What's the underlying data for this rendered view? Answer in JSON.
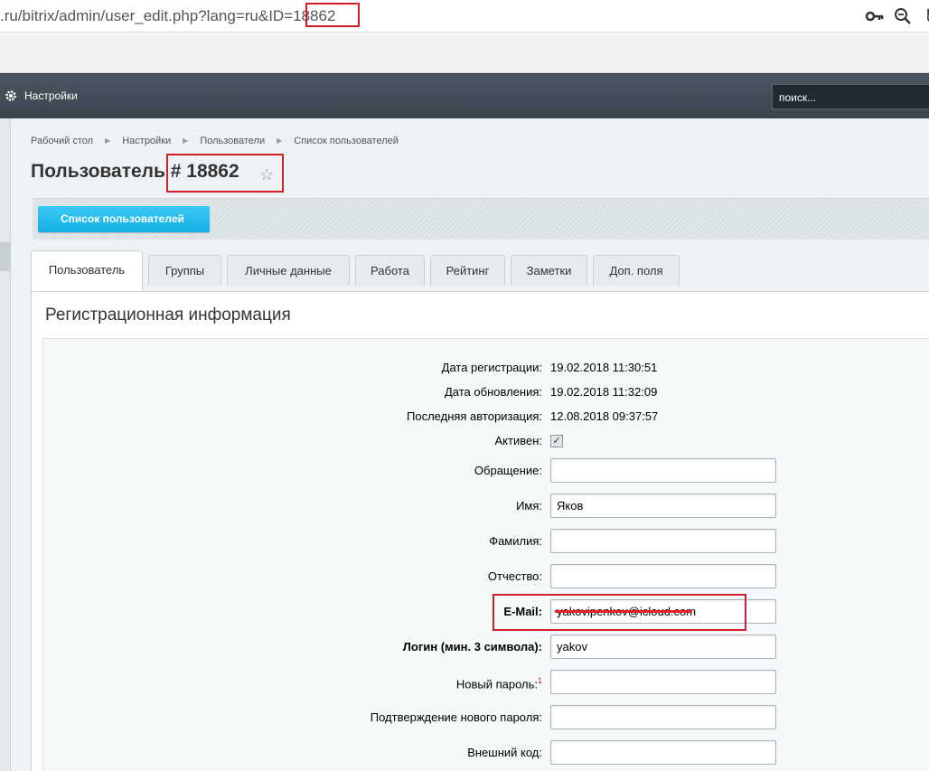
{
  "browser": {
    "url_prefix": ".ru/bitrix/admin/user_edit.php?lang=ru&ID=",
    "url_id": "18862"
  },
  "panel": {
    "settings_label": "Настройки",
    "search_placeholder": "поиск..."
  },
  "breadcrumb": [
    "Рабочий стол",
    "Настройки",
    "Пользователи",
    "Список пользователей"
  ],
  "page": {
    "title": "Пользователь # 18862",
    "list_button": "Список пользователей"
  },
  "tabs": [
    "Пользователь",
    "Группы",
    "Личные данные",
    "Работа",
    "Рейтинг",
    "Заметки",
    "Доп. поля"
  ],
  "form": {
    "section_title": "Регистрационная информация",
    "fields": {
      "reg_date": {
        "label": "Дата регистрации:",
        "value": "19.02.2018 11:30:51"
      },
      "update_date": {
        "label": "Дата обновления:",
        "value": "19.02.2018 11:32:09"
      },
      "last_login": {
        "label": "Последняя авторизация:",
        "value": "12.08.2018 09:37:57"
      },
      "active": {
        "label": "Активен:",
        "checked": true
      },
      "title": {
        "label": "Обращение:",
        "value": ""
      },
      "name": {
        "label": "Имя:",
        "value": "Яков"
      },
      "last_name": {
        "label": "Фамилия:",
        "value": ""
      },
      "second_name": {
        "label": "Отчество:",
        "value": ""
      },
      "email": {
        "label": "E-Mail:",
        "value": "yakovipenkov@icloud.com"
      },
      "login": {
        "label": "Логин (мин. 3 символа):",
        "value": "yakov"
      },
      "new_password": {
        "label": "Новый пароль:",
        "note": "1",
        "value": ""
      },
      "confirm_password": {
        "label": "Подтверждение нового пароля:",
        "value": ""
      },
      "external_code": {
        "label": "Внешний код:",
        "value": ""
      }
    }
  },
  "colors": {
    "annotation": "#d01f2b",
    "panel": "#3f4a55",
    "button": "#22bbeb"
  }
}
